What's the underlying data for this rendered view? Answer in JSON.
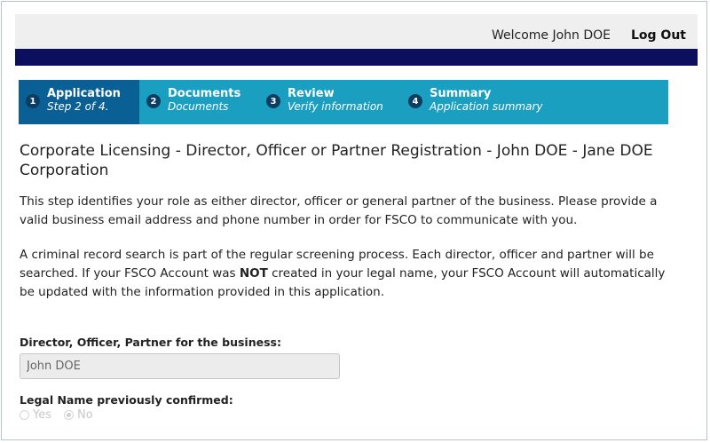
{
  "header": {
    "welcome_text": "Welcome John DOE",
    "logout_label": "Log Out"
  },
  "steps": [
    {
      "number": "1",
      "title": "Application",
      "subtitle": "Step 2 of 4."
    },
    {
      "number": "2",
      "title": "Documents",
      "subtitle": "Documents"
    },
    {
      "number": "3",
      "title": "Review",
      "subtitle": "Verify information"
    },
    {
      "number": "4",
      "title": "Summary",
      "subtitle": "Application summary"
    }
  ],
  "page": {
    "title": "Corporate Licensing - Director, Officer or Partner Registration - John DOE - Jane DOE Corporation",
    "intro": "This step identifies your role as either director, officer or general partner of the business. Please provide a valid business email address and phone number in order for FSCO to communicate with you.",
    "criminal_pre": "A criminal record search is part of the regular screening process. Each director, officer and partner will be searched. If your FSCO Account was ",
    "criminal_bold": "NOT",
    "criminal_post": " created in your legal name, your FSCO Account will automatically be updated with the information provided in this application."
  },
  "form": {
    "director_label": "Director, Officer, Partner for the business:",
    "director_value": "John DOE",
    "legal_name_label": "Legal Name previously confirmed:",
    "legal_name_options": [
      "Yes",
      "No"
    ],
    "legal_name_selected": "No"
  },
  "colors": {
    "topbar": "#efefef",
    "navybar": "#0b0f5e",
    "steps_bg": "#1b9fc1",
    "step_active": "#0a5f94"
  }
}
